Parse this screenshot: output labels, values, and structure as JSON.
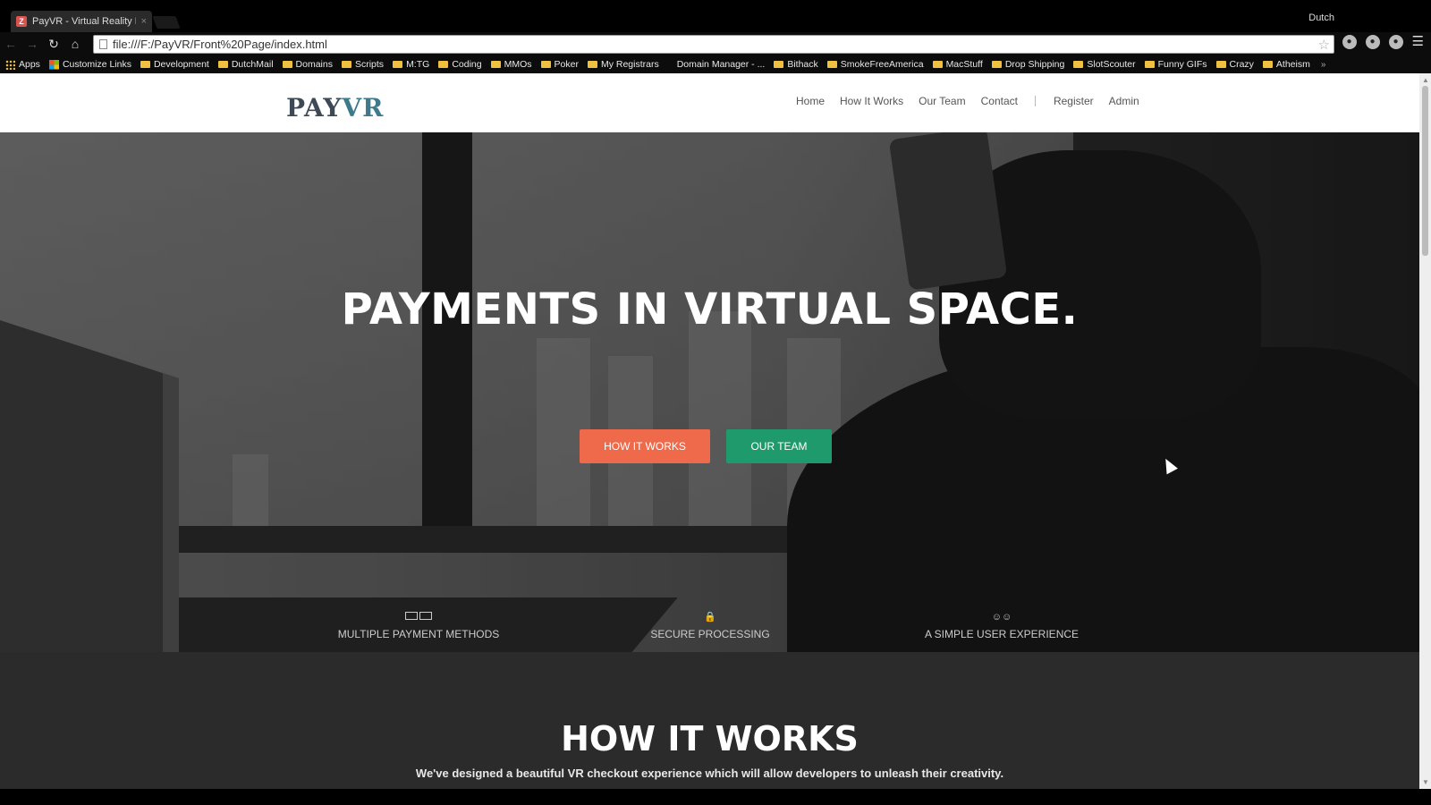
{
  "browser": {
    "tab_title": "PayVR - Virtual Reality Pa",
    "tab_close": "×",
    "profile_name": "Dutch",
    "url": "file:///F:/PayVR/Front%20Page/index.html",
    "bookmarks": [
      {
        "label": "Apps",
        "icon": "apps-grid-icon"
      },
      {
        "label": "Customize Links",
        "icon": "microsoft-icon"
      },
      {
        "label": "Development",
        "icon": "folder-icon"
      },
      {
        "label": "DutchMail",
        "icon": "folder-icon"
      },
      {
        "label": "Domains",
        "icon": "folder-icon"
      },
      {
        "label": "Scripts",
        "icon": "folder-icon"
      },
      {
        "label": "M:TG",
        "icon": "folder-icon"
      },
      {
        "label": "Coding",
        "icon": "folder-icon"
      },
      {
        "label": "MMOs",
        "icon": "folder-icon"
      },
      {
        "label": "Poker",
        "icon": "folder-icon"
      },
      {
        "label": "My Registrars",
        "icon": "folder-icon"
      },
      {
        "label": "Domain Manager - ...",
        "icon": "page-icon"
      },
      {
        "label": "Bithack",
        "icon": "folder-icon"
      },
      {
        "label": "SmokeFreeAmerica",
        "icon": "folder-icon"
      },
      {
        "label": "MacStuff",
        "icon": "folder-icon"
      },
      {
        "label": "Drop Shipping",
        "icon": "folder-icon"
      },
      {
        "label": "SlotScouter",
        "icon": "folder-icon"
      },
      {
        "label": "Funny GIFs",
        "icon": "folder-icon"
      },
      {
        "label": "Crazy",
        "icon": "folder-icon"
      },
      {
        "label": "Atheism",
        "icon": "folder-icon"
      }
    ],
    "bookmarks_more": "»"
  },
  "site": {
    "logo_pay": "PAY",
    "logo_vr": "VR",
    "nav": [
      {
        "label": "Home"
      },
      {
        "label": "How It Works"
      },
      {
        "label": "Our Team"
      },
      {
        "label": "Contact"
      }
    ],
    "nav_right": [
      {
        "label": "Register"
      },
      {
        "label": "Admin"
      }
    ],
    "hero_title": "PAYMENTS IN VIRTUAL SPACE.",
    "btn_how": "HOW IT WORKS",
    "btn_team": "OUR TEAM",
    "features": [
      {
        "label": "MULTIPLE PAYMENT METHODS",
        "icon": "credit-cards-icon"
      },
      {
        "label": "SECURE PROCESSING",
        "icon": "lock-icon"
      },
      {
        "label": "A SIMPLE USER EXPERIENCE",
        "icon": "users-icon"
      }
    ],
    "section_title": "HOW IT WORKS",
    "section_sub": "We've designed a beautiful VR checkout experience which will allow developers to unleash their creativity."
  },
  "colors": {
    "accent_orange": "#ee6a4a",
    "accent_green": "#1f9a6c",
    "logo_dark": "#3d4a56",
    "logo_vr": "#3d7a8c"
  }
}
